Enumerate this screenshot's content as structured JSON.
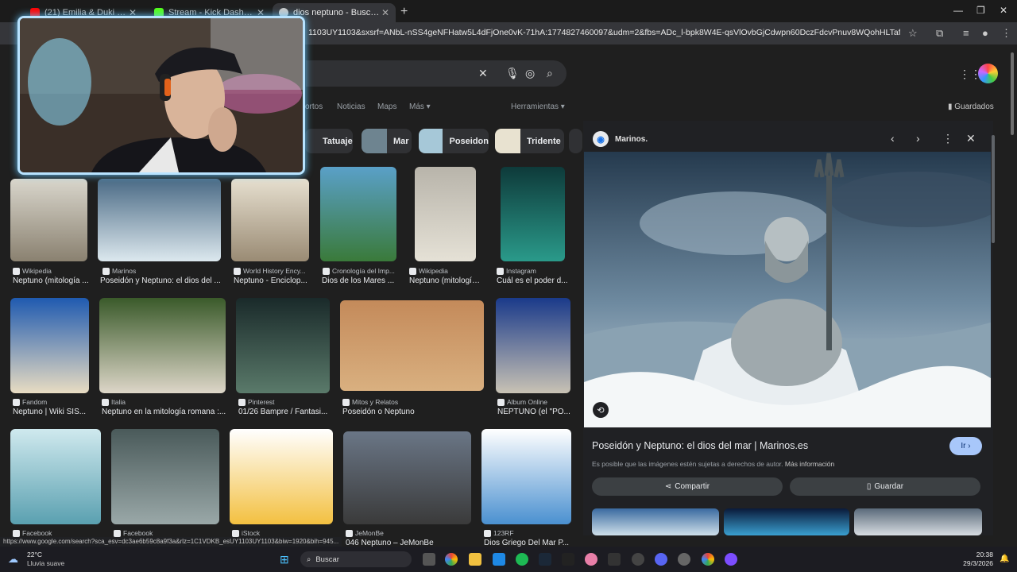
{
  "tabs": [
    {
      "label": "(21) Emilia & Duki – Como Si N",
      "fav": "#ff0000"
    },
    {
      "label": "Stream - Kick Dashboard",
      "fav": "#53fc18"
    },
    {
      "label": "dios neptuno - Buscar con Goo",
      "fav": "#c8c8c8"
    }
  ],
  "address": {
    "url": "1103UY1103&sxsrf=ANbL-nSS4geNFHatw5L4dFjOne0vK-71hA:1774827460097&udm=2&fbs=ADc_l-bpk8W4E-qsVlOvbGjCdwpn60DczFdcvPnuv8WQohHLTaf9fS4tU71bi2aHS-Pme..."
  },
  "nav_tabs": [
    "ortos",
    "Noticias",
    "Maps",
    "Más ▾",
    "Herramientas ▾"
  ],
  "saved_label": "Guardados",
  "chips": [
    {
      "label": "Tatuaje",
      "color": "#1e3040"
    },
    {
      "label": "Mar",
      "color": "#6e8490"
    },
    {
      "label": "Poseidon",
      "color": "#a6c8d8"
    },
    {
      "label": "Tridente",
      "color": "#e8e2d0"
    }
  ],
  "results_row1": [
    {
      "source": "Wikipedia",
      "caption": "Neptuno (mitología ...",
      "c1": "#d9d6cc",
      "c2": "#8a8170"
    },
    {
      "source": "Marinos",
      "caption": "Poseidón y Neptuno: el dios del ...",
      "c1": "#4a6a85",
      "c2": "#dce8ee"
    },
    {
      "source": "World History Ency...",
      "caption": "Neptuno - Enciclop...",
      "c1": "#e6dfcf",
      "c2": "#9a8b74"
    },
    {
      "source": "Cronología del Imp...",
      "caption": "Dios de los Mares ...",
      "c1": "#5aa0c8",
      "c2": "#3a7a3a"
    },
    {
      "source": "Wikipedia",
      "caption": "Neptuno (mitología...",
      "c1": "#b8b4aa",
      "c2": "#e5e1d6"
    },
    {
      "source": "Instagram",
      "caption": "Cuál es el poder d...",
      "c1": "#0e3a3a",
      "c2": "#2a9a8a"
    }
  ],
  "results_row2": [
    {
      "source": "Fandom",
      "caption": "Neptuno | Wiki SIS...",
      "c1": "#1f5ab0",
      "c2": "#e8dcc2"
    },
    {
      "source": "Italia",
      "caption": "Neptuno en la mitología romana :...",
      "c1": "#3a5a2a",
      "c2": "#ddd6c8"
    },
    {
      "source": "Pinterest",
      "caption": "01/26 Bampre / Fantasi...",
      "c1": "#1a2a2a",
      "c2": "#5a7a6a"
    },
    {
      "source": "Mitos y Relatos",
      "caption": "Poseidón o Neptuno",
      "c1": "#c48a5a",
      "c2": "#d9b080"
    },
    {
      "source": "Album Online",
      "caption": "NEPTUNO (el \"PO...",
      "c1": "#1a3a8a",
      "c2": "#c8c2b4"
    }
  ],
  "results_row3": [
    {
      "source": "Facebook",
      "caption": "",
      "c1": "#cfe9ee",
      "c2": "#5aa0b0"
    },
    {
      "source": "Facebook",
      "caption": "",
      "c1": "#4a5a5a",
      "c2": "#9aa8a8"
    },
    {
      "source": "iStock",
      "caption": "",
      "c1": "#ffffff",
      "c2": "#f3c040"
    },
    {
      "source": "JeMonBe",
      "caption": "046 Neptuno – JeMonBe",
      "c1": "#6a7686",
      "c2": "#3a3a3a"
    },
    {
      "source": "123RF",
      "caption": "Dios Griego Del Mar P...",
      "c1": "#ffffff",
      "c2": "#4a90d0"
    }
  ],
  "panel": {
    "site": "Marinos.",
    "title": "Poseidón y Neptuno: el dios del mar | Marinos.es",
    "note": "Es posible que las imágenes estén sujetas a derechos de autor.",
    "more_info": "Más información",
    "go_label": "Ir ›",
    "share_label": "Compartir",
    "save_label": "Guardar"
  },
  "status_url": "https://www.google.com/search?sca_esv=dc3ae6b59c8a9f3a&rlz=1C1VDKB_esUY1103UY1103&biw=1920&bih=945...",
  "taskbar": {
    "temperature": "22°C",
    "weather": "Lluvia suave",
    "search": "Buscar",
    "time": "20:38",
    "date": "29/3/2026"
  }
}
